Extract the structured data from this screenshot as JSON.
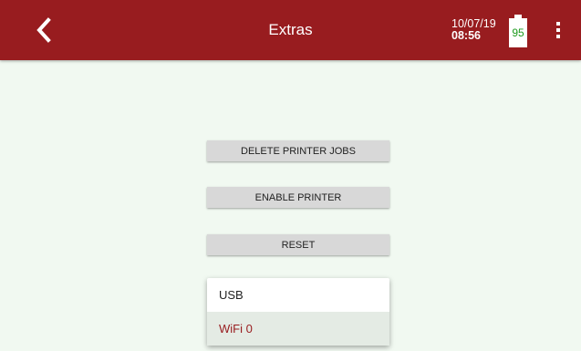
{
  "app_bar": {
    "title": "Extras",
    "back_icon": "chevron-left-icon",
    "date": "10/07/19",
    "time": "08:56",
    "battery_level": "95",
    "menu_icon": "more-vertical-icon"
  },
  "actions": {
    "delete_printer_jobs": "DELETE PRINTER JOBS",
    "enable_printer": "ENABLE PRINTER",
    "reset": "RESET"
  },
  "dropdown": {
    "options": [
      "USB",
      "WiFi 0"
    ],
    "selected": "WiFi 0"
  },
  "colors": {
    "app_bar": "#981c1f",
    "background": "#f1f9f1",
    "battery_text": "#1f9a1f",
    "selected_text": "#981c1f"
  }
}
